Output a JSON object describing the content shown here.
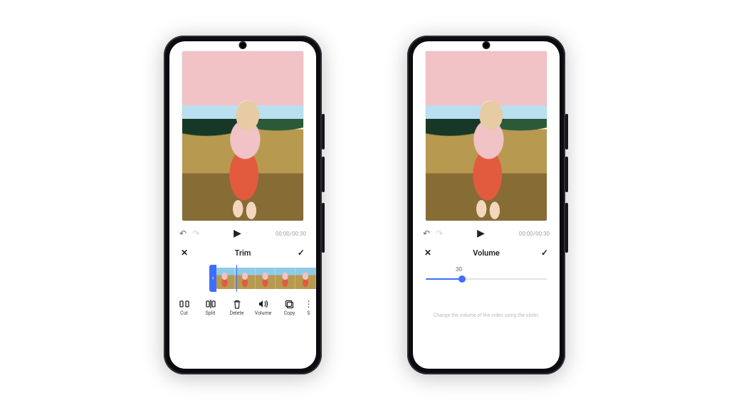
{
  "timecode": "00:00/00:30",
  "left": {
    "panel_title": "Trim",
    "tools": [
      {
        "label": "Cut",
        "icon": "cut-icon"
      },
      {
        "label": "Split",
        "icon": "split-icon"
      },
      {
        "label": "Delete",
        "icon": "delete-icon"
      },
      {
        "label": "Volume",
        "icon": "volume-icon"
      },
      {
        "label": "Copy",
        "icon": "copy-icon"
      },
      {
        "label": "S",
        "icon": "more-icon"
      }
    ]
  },
  "right": {
    "panel_title": "Volume",
    "volume_value": "30",
    "volume_pct": 30,
    "hint": "Change the volume of the video using the slider."
  }
}
